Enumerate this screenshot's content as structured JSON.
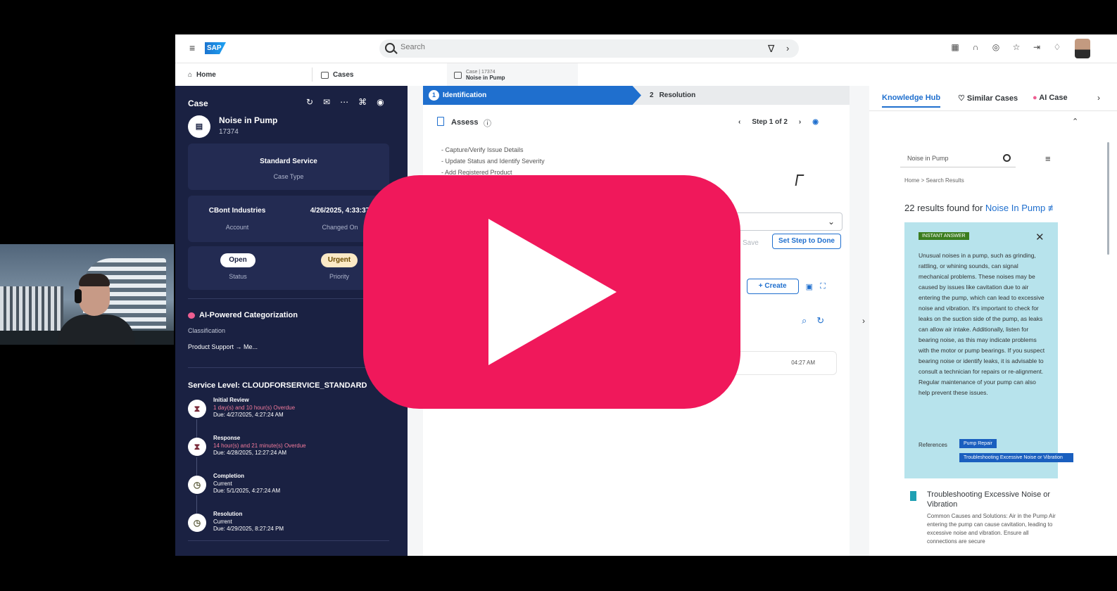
{
  "shell": {
    "logo": "SAP",
    "search_placeholder": "Search"
  },
  "tabs": {
    "home": "Home",
    "cases": "Cases",
    "case_line1": "Case | 17374",
    "case_line2": "Noise in Pump"
  },
  "case": {
    "header": "Case",
    "name": "Noise in Pump",
    "id": "17374",
    "type_value": "Standard Service",
    "type_label": "Case Type",
    "account_value": "CBont Industries",
    "account_label": "Account",
    "changed_value": "4/26/2025, 4:33:37",
    "changed_label": "Changed On",
    "status_value": "Open",
    "status_label": "Status",
    "priority_value": "Urgent",
    "priority_label": "Priority",
    "ai_title": "AI-Powered Categorization",
    "classification_label": "Classification",
    "classification_value": "Product Support → Me...",
    "service_level_title": "Service Level: CLOUDFORSERVICE_STANDARD",
    "service_items": [
      {
        "name": "Initial Review",
        "status": "1 day(s) and 10 hour(s) Overdue",
        "due": "Due: 4/27/2025, 4:27:24 AM"
      },
      {
        "name": "Response",
        "status": "14 hour(s) and 21 minute(s) Overdue",
        "due": "Due: 4/28/2025, 12:27:24 AM"
      },
      {
        "name": "Completion",
        "status": "Current",
        "due": "Due: 5/1/2025, 4:27:24 AM"
      },
      {
        "name": "Resolution",
        "status": "Current",
        "due": "Due: 4/29/2025, 8:27:24 PM"
      }
    ]
  },
  "steps": {
    "step1_num": "1",
    "step1_label": "Identification",
    "step2_num": "2",
    "step2_label": "Resolution",
    "assess_title": "Assess",
    "step_indicator": "Step 1 of 2",
    "bullets": [
      "- Capture/Verify Issue Details",
      "- Update Status and Identify Severity",
      "- Add Registered Product"
    ],
    "save_label": "Save",
    "done_label": "Set Step to Done",
    "create_label": "Create",
    "timeline_time": "04:27 AM"
  },
  "knowledge": {
    "tab_hub": "Knowledge Hub",
    "tab_similar": "Similar Cases",
    "tab_ai": "AI Case",
    "search_value": "Noise in Pump",
    "breadcrumb": "Home  >  Search Results",
    "results_prefix": "22 results found for",
    "results_query": "Noise In Pump",
    "instant_tag": "INSTANT ANSWER",
    "instant_text": "Unusual noises in a pump, such as grinding, rattling, or whining sounds, can signal mechanical problems. These noises may be caused by issues like cavitation due to air entering the pump, which can lead to excessive noise and vibration. It's important to check for leaks on the suction side of the pump, as leaks can allow air intake. Additionally, listen for bearing noise, as this may indicate problems with the motor or pump bearings. If you suspect bearing noise or identify leaks, it is advisable to consult a technician for repairs or re-alignment. Regular maintenance of your pump can also help prevent these issues.",
    "references_label": "References",
    "ref_1": "Pump Repair",
    "ref_2": "Troubleshooting Excessive Noise or Vibration",
    "article_title": "Troubleshooting Excessive Noise or Vibration",
    "article_snippet": "Common Causes and Solutions: Air in the Pump Air entering the pump can cause cavitation, leading to excessive noise and vibration. Ensure all connections are secure"
  }
}
